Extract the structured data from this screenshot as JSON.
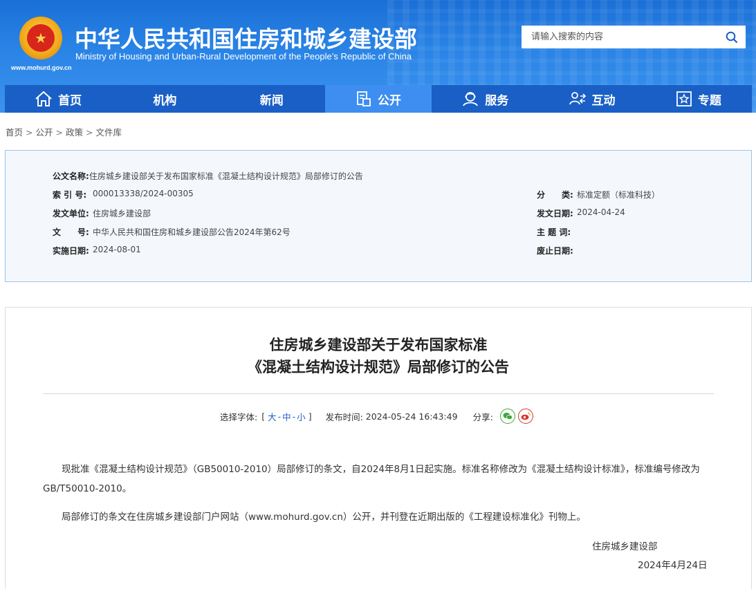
{
  "header": {
    "title": "中华人民共和国住房和城乡建设部",
    "subtitle": "Ministry of Housing and Urban-Rural Development of the People’s Republic of China",
    "site_url": "www.mohurd.gov.cn",
    "search_placeholder": "请输入搜索的内容"
  },
  "nav": {
    "items": [
      {
        "label": "首页",
        "icon": "home-icon"
      },
      {
        "label": "机构",
        "icon": ""
      },
      {
        "label": "新闻",
        "icon": ""
      },
      {
        "label": "公开",
        "icon": "document-icon"
      },
      {
        "label": "服务",
        "icon": "service-icon"
      },
      {
        "label": "互动",
        "icon": "interaction-icon"
      },
      {
        "label": "专题",
        "icon": "star-icon"
      }
    ],
    "active_index": 3
  },
  "breadcrumb": [
    "首页",
    "公开",
    "政策",
    "文件库"
  ],
  "info": {
    "doc_name_label": "公文名称:",
    "doc_name": "住房城乡建设部关于发布国家标准《混凝土结构设计规范》局部修订的公告",
    "index_label": "索 引 号:",
    "index": "000013338/2024-00305",
    "category_label": "分　　类:",
    "category": "标准定额（标准科技）",
    "issuer_label": "发文单位:",
    "issuer": "住房城乡建设部",
    "issue_date_label": "发文日期:",
    "issue_date": "2024-04-24",
    "doc_no_label": "文　　号:",
    "doc_no": "中华人民共和国住房和城乡建设部公告2024年第62号",
    "keywords_label": "主 题 词:",
    "keywords": "",
    "effective_label": "实施日期:",
    "effective": "2024-08-01",
    "repeal_label": "废止日期:",
    "repeal": ""
  },
  "article": {
    "title_line1": "住房城乡建设部关于发布国家标准",
    "title_line2": "《混凝土结构设计规范》局部修订的公告",
    "font_choice_label": "选择字体:",
    "font_bracket_open": "[",
    "font_large": "大",
    "font_medium": "中",
    "font_small": "小",
    "font_bracket_close": "]",
    "dash": "-",
    "publish_label": "发布时间:",
    "publish_time": "2024-05-24 16:43:49",
    "share_label": "分享:",
    "para1": "现批准《混凝土结构设计规范》（GB50010-2010）局部修订的条文，自2024年8月1日起实施。标准名称修改为《混凝土结构设计标准》，标准编号修改为GB/T50010-2010。",
    "para2": "局部修订的条文在住房城乡建设部门户网站（www.mohurd.gov.cn）公开，并刊登在近期出版的《工程建设标准化》刊物上。",
    "sign_org": "住房城乡建设部",
    "sign_date": "2024年4月24日"
  },
  "colors": {
    "nav_bg": "#1a5fc6",
    "nav_active": "#3d8ef0",
    "info_bg": "#f4f8fd",
    "info_border": "#9fc2e7",
    "link_blue": "#1a5fc6"
  }
}
